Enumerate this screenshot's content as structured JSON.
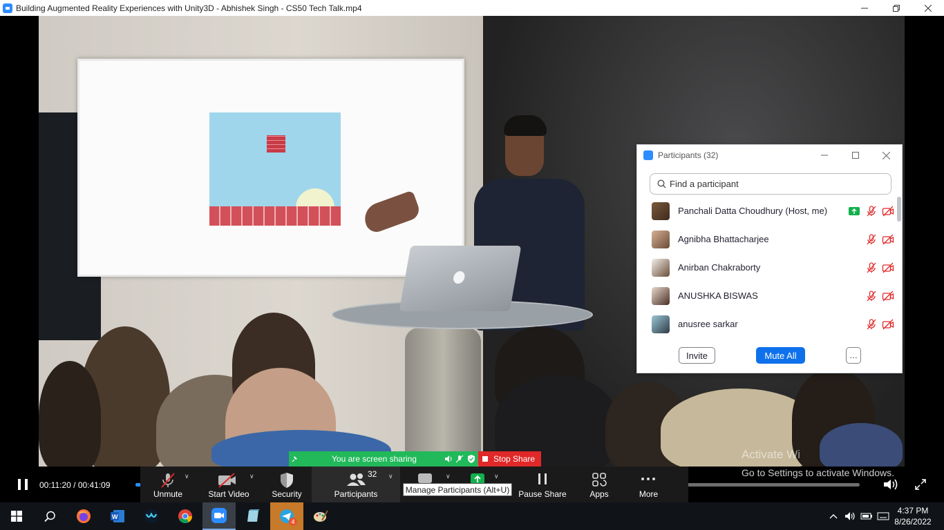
{
  "window": {
    "title": "Building Augmented Reality Experiences with Unity3D - Abhishek Singh - CS50 Tech Talk.mp4",
    "controls": [
      "minimize",
      "restore",
      "close"
    ]
  },
  "participants_panel": {
    "title": "Participants (32)",
    "search_placeholder": "Find a participant",
    "participants": [
      {
        "name": "Panchali Datta Choudhury (Host, me)",
        "sharing": true,
        "muted": true,
        "video_off": true
      },
      {
        "name": "Agnibha Bhattacharjee",
        "sharing": false,
        "muted": true,
        "video_off": true
      },
      {
        "name": "Anirban Chakraborty",
        "sharing": false,
        "muted": true,
        "video_off": true
      },
      {
        "name": "ANUSHKA BISWAS",
        "sharing": false,
        "muted": true,
        "video_off": true
      },
      {
        "name": "anusree sarkar",
        "sharing": false,
        "muted": true,
        "video_off": true
      }
    ],
    "invite_label": "Invite",
    "mute_all_label": "Mute All",
    "more_label": "…"
  },
  "share_banner": {
    "text": "You are screen sharing",
    "stop_label": "Stop Share"
  },
  "player": {
    "time": "00:11:20 / 00:41:09",
    "progress": 0.275
  },
  "toolbar": {
    "unmute": "Unmute",
    "start_video": "Start Video",
    "security": "Security",
    "participants": "Participants",
    "participants_count": "32",
    "pause_share": "Pause Share",
    "apps": "Apps",
    "more": "More",
    "tooltip": "Manage Participants (Alt+U)"
  },
  "watermark": {
    "line1": "Activate Wi",
    "line2": "Go to Settings to activate Windows."
  },
  "taskbar": {
    "time": "4:37 PM",
    "date": "8/26/2022",
    "telegram_badge": "4"
  },
  "colors": {
    "zoom_blue": "#0e71eb",
    "share_green": "#21b95a",
    "stop_red": "#e02828",
    "mute_red": "#e02828"
  }
}
